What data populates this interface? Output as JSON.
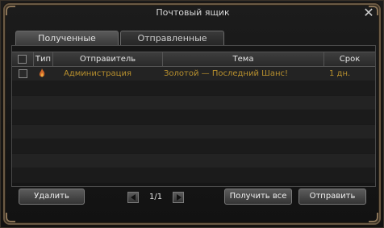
{
  "window": {
    "title": "Почтовый ящик",
    "close_icon": "close-icon"
  },
  "tabs": [
    {
      "label": "Полученные",
      "active": true
    },
    {
      "label": "Отправленные",
      "active": false
    }
  ],
  "table": {
    "columns": [
      "Тип",
      "Отправитель",
      "Тема",
      "Срок"
    ],
    "rows": [
      {
        "type_icon": "fire-icon",
        "sender": "Администрация",
        "subject": "Золотой — Последний Шанс!",
        "term": "1 дн."
      }
    ],
    "text_color": "#b8902e"
  },
  "footer": {
    "delete_label": "Удалить",
    "page": "1/1",
    "receive_all_label": "Получить все",
    "send_label": "Отправить"
  }
}
